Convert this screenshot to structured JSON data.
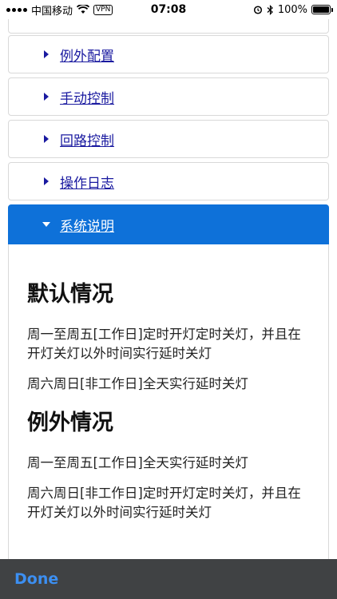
{
  "status_bar": {
    "carrier": "中国移动",
    "vpn": "VPN",
    "time": "07:08",
    "battery": "100%",
    "battery_fill": 1.0
  },
  "menu": {
    "items": [
      {
        "label": "例外配置"
      },
      {
        "label": "手动控制"
      },
      {
        "label": "回路控制"
      },
      {
        "label": "操作日志"
      },
      {
        "label": "系统说明",
        "active": true
      }
    ]
  },
  "description": {
    "default_heading": "默认情况",
    "default_p1": "周一至周五[工作日]定时开灯定时关灯，并且在开灯关灯以外时间实行延时关灯",
    "default_p2": "周六周日[非工作日]全天实行延时关灯",
    "exception_heading": "例外情况",
    "exception_p1": "周一至周五[工作日]全天实行延时关灯",
    "exception_p2": "周六周日[非工作日]定时开灯定时关灯，并且在开灯关灯以外时间实行延时关灯"
  },
  "toolbar": {
    "done_label": "Done"
  },
  "colors": {
    "active_panel": "#0e71d9",
    "link": "#1a1aa0",
    "done": "#3c8ff2",
    "toolbar_bg": "#404244"
  }
}
